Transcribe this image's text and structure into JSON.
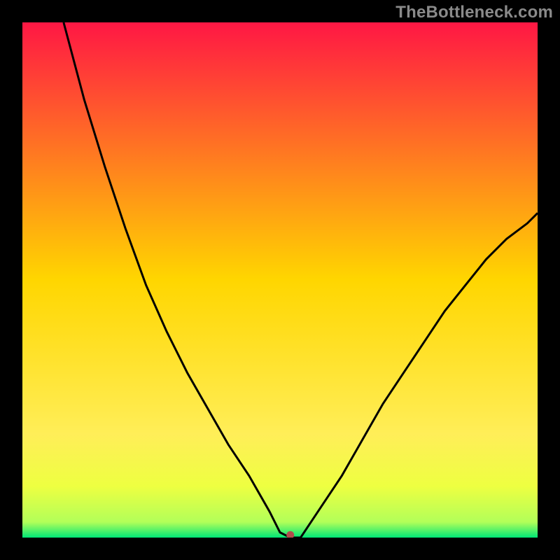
{
  "watermark": {
    "text": "TheBottleneck.com"
  },
  "chart_data": {
    "type": "line",
    "title": "",
    "xlabel": "",
    "ylabel": "",
    "xlim": [
      0,
      100
    ],
    "ylim": [
      0,
      100
    ],
    "grid": false,
    "legend": false,
    "background_gradient": {
      "stops": [
        {
          "offset": 0.0,
          "color": "#ff1744"
        },
        {
          "offset": 0.5,
          "color": "#ffd600"
        },
        {
          "offset": 0.8,
          "color": "#ffee58"
        },
        {
          "offset": 0.9,
          "color": "#eeff41"
        },
        {
          "offset": 0.97,
          "color": "#b2ff59"
        },
        {
          "offset": 1.0,
          "color": "#00e676"
        }
      ]
    },
    "description": "V-shaped black curve on a vertical red-to-green heat gradient. Sharp minimum near x≈52, y≈0. Left branch rises steeply to y=100 at x≈8; right branch rises more gently to y≈63 at x=100. Small red dot marks the minimum.",
    "series": [
      {
        "name": "curve",
        "color": "#000000",
        "x": [
          8,
          12,
          16,
          20,
          24,
          28,
          32,
          36,
          40,
          44,
          48,
          50,
          52,
          54,
          58,
          62,
          66,
          70,
          74,
          78,
          82,
          86,
          90,
          94,
          98,
          100
        ],
        "values": [
          100,
          85,
          72,
          60,
          49,
          40,
          32,
          25,
          18,
          12,
          5,
          1,
          0,
          0,
          6,
          12,
          19,
          26,
          32,
          38,
          44,
          49,
          54,
          58,
          61,
          63
        ]
      }
    ],
    "marker": {
      "x": 52,
      "y": 0.5,
      "color": "#b24b4b",
      "radius": 6
    }
  }
}
